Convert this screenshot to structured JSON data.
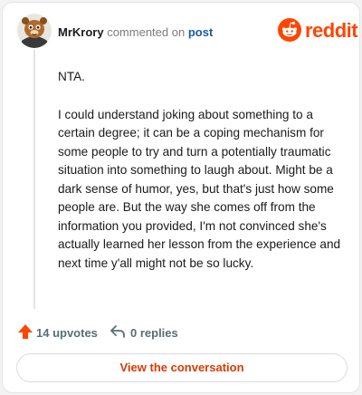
{
  "comment": {
    "author": "MrKrory",
    "action_text": "commented on",
    "post_link": "post",
    "brand": "reddit",
    "paragraphs": [
      "NTA.",
      "I could understand joking about something to a certain degree; it can be a coping mechanism for some people to try and turn a potentially traumatic situation into something to laugh about. Might be a dark sense of humor, yes, but that's just how some people are. But the way she comes off from the information you provided, I'm not convinced she's actually learned her lesson from the experience and next time y'all might not be so lucky."
    ],
    "upvotes": "14 upvotes",
    "replies": "0 replies",
    "view_button": "View the conversation"
  },
  "colors": {
    "brand": "#ff4500",
    "upvote": "#ff4500",
    "link": "#1a5aa0",
    "button_text": "#d93a00"
  },
  "icons": {
    "avatar": "snoo-avatar",
    "brand_icon": "reddit-snoo-icon",
    "upvote": "upvote-arrow-icon",
    "reply": "reply-arrow-icon"
  }
}
